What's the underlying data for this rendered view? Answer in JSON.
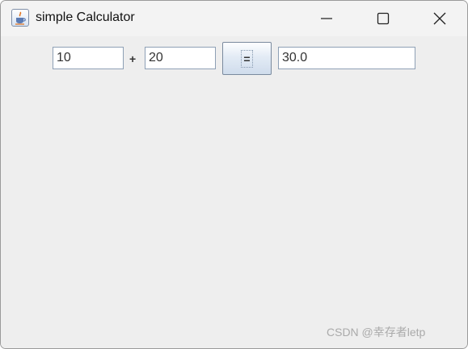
{
  "window": {
    "title": "simple Calculator"
  },
  "calculator": {
    "operand1": "10",
    "operator": "+",
    "operand2": "20",
    "equals_label": "=",
    "result": "30.0"
  },
  "watermark": "CSDN @幸存者letp",
  "icons": {
    "app": "java-coffee-cup-icon",
    "minimize": "minimize-icon",
    "maximize": "maximize-icon",
    "close": "close-icon"
  }
}
